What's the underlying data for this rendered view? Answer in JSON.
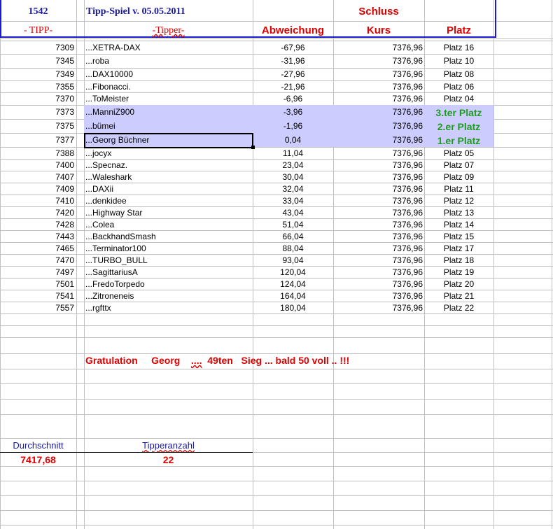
{
  "header": {
    "number": "1542",
    "title": "Tipp-Spiel v. 05.05.2011",
    "schluss": "Schluss",
    "col_tipp": "- TIPP-",
    "col_tipper": "-Tipper-",
    "col_abweichung": "Abweichung",
    "col_kurs": "Kurs",
    "col_platz": "Platz"
  },
  "rows": [
    {
      "tipp": "7309",
      "name": "...XETRA-DAX",
      "abw": "-67,96",
      "kurs": "7376,96",
      "platz": "Platz 16",
      "top": false
    },
    {
      "tipp": "7345",
      "name": "...roba",
      "abw": "-31,96",
      "kurs": "7376,96",
      "platz": "Platz 10",
      "top": false
    },
    {
      "tipp": "7349",
      "name": "...DAX10000",
      "abw": "-27,96",
      "kurs": "7376,96",
      "platz": "Platz 08",
      "top": false
    },
    {
      "tipp": "7355",
      "name": "...Fibonacci.",
      "abw": "-21,96",
      "kurs": "7376,96",
      "platz": "Platz 06",
      "top": false
    },
    {
      "tipp": "7370",
      "name": "...ToMeister",
      "abw": "-6,96",
      "kurs": "7376,96",
      "platz": "Platz 04",
      "top": false
    },
    {
      "tipp": "7373",
      "name": "...ManniZ900",
      "abw": "-3,96",
      "kurs": "7376,96",
      "platz": "3.ter Platz",
      "top": true
    },
    {
      "tipp": "7375",
      "name": "...bümei",
      "abw": "-1,96",
      "kurs": "7376,96",
      "platz": "2.er Platz",
      "top": true
    },
    {
      "tipp": "7377",
      "name": "...Georg  Büchner",
      "abw": "0,04",
      "kurs": "7376,96",
      "platz": "1.er Platz",
      "top": true
    },
    {
      "tipp": "7388",
      "name": "...jocyx",
      "abw": "11,04",
      "kurs": "7376,96",
      "platz": "Platz 05",
      "top": false
    },
    {
      "tipp": "7400",
      "name": "...Specnaz.",
      "abw": "23,04",
      "kurs": "7376,96",
      "platz": "Platz 07",
      "top": false
    },
    {
      "tipp": "7407",
      "name": "...Waleshark",
      "abw": "30,04",
      "kurs": "7376,96",
      "platz": "Platz 09",
      "top": false
    },
    {
      "tipp": "7409",
      "name": "...DAXii",
      "abw": "32,04",
      "kurs": "7376,96",
      "platz": "Platz 11",
      "top": false
    },
    {
      "tipp": "7410",
      "name": "...denkidee",
      "abw": "33,04",
      "kurs": "7376,96",
      "platz": "Platz 12",
      "top": false
    },
    {
      "tipp": "7420",
      "name": "...Highway Star",
      "abw": "43,04",
      "kurs": "7376,96",
      "platz": "Platz 13",
      "top": false
    },
    {
      "tipp": "7428",
      "name": "...Colea",
      "abw": "51,04",
      "kurs": "7376,96",
      "platz": "Platz 14",
      "top": false
    },
    {
      "tipp": "7443",
      "name": "...BackhandSmash",
      "abw": "66,04",
      "kurs": "7376,96",
      "platz": "Platz 15",
      "top": false
    },
    {
      "tipp": "7465",
      "name": "...Terminator100",
      "abw": "88,04",
      "kurs": "7376,96",
      "platz": "Platz 17",
      "top": false
    },
    {
      "tipp": "7470",
      "name": "...TURBO_BULL",
      "abw": "93,04",
      "kurs": "7376,96",
      "platz": "Platz 18",
      "top": false
    },
    {
      "tipp": "7497",
      "name": "...SagittariusA",
      "abw": "120,04",
      "kurs": "7376,96",
      "platz": "Platz 19",
      "top": false
    },
    {
      "tipp": "7501",
      "name": "...FredoTorpedo",
      "abw": "124,04",
      "kurs": "7376,96",
      "platz": "Platz 20",
      "top": false
    },
    {
      "tipp": "7541",
      "name": "...Zitroneneis",
      "abw": "164,04",
      "kurs": "7376,96",
      "platz": "Platz 21",
      "top": false
    },
    {
      "tipp": "7557",
      "name": "...rgfttx",
      "abw": "180,04",
      "kurs": "7376,96",
      "platz": "Platz 22",
      "top": false
    }
  ],
  "message": {
    "part1": "Gratulation",
    "part2": "Georg",
    "part3": "....",
    "part4": "49ten",
    "part5": "Sieg ... bald 50 voll .. !!!"
  },
  "summary": {
    "avg_label": "Durchschnitt",
    "avg_value": "7417,68",
    "count_label": "Tipperanzahl",
    "count_value": "22"
  },
  "colors": {
    "highlight": "#ccccff",
    "red": "#e00000",
    "blue": "#1a1aa0",
    "green": "#1e9a1e"
  }
}
